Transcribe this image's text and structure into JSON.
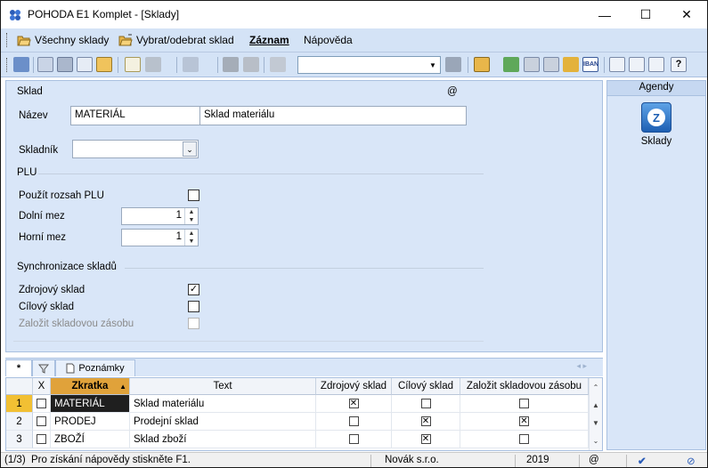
{
  "window": {
    "title": "POHODA E1 Komplet - [Sklady]",
    "minimize": "—",
    "maximize": "☐",
    "close": "✕"
  },
  "menubar": {
    "items": [
      {
        "label": "Všechny sklady",
        "icon": "folder-open-icon"
      },
      {
        "label": "Vybrat/odebrat sklad",
        "icon": "folder-select-icon"
      },
      {
        "label": "Záznam"
      },
      {
        "label": "Nápověda"
      }
    ]
  },
  "toolbar": {
    "filter_value": "",
    "icons": [
      "exit-icon",
      "copy-icon",
      "print-icon",
      "preview-icon",
      "export-icon",
      "new-record-icon",
      "check-icon",
      "back-arrow-icon",
      "save-icon",
      "save-disabled-icon",
      "duplicate-icon",
      "filter-icon",
      "folder-icon",
      "money-icon",
      "calculator-icon",
      "calc2-icon",
      "coins-icon",
      "iban-icon",
      "payments-icon",
      "list-icon",
      "report-icon",
      "help-icon"
    ]
  },
  "form": {
    "sklad_section": "Sklad",
    "at_label": "@",
    "nazev_label": "Název",
    "nazev_code": "MATERIÁL",
    "nazev_text": "Sklad materiálu",
    "skladnik_label": "Skladník",
    "skladnik_value": "",
    "plu_section": "PLU",
    "pouzit_rozsah_label": "Použít rozsah PLU",
    "pouzit_rozsah_checked": false,
    "dolni_mez_label": "Dolní mez",
    "dolni_mez_value": "1",
    "horni_mez_label": "Horní mez",
    "horni_mez_value": "1",
    "sync_section": "Synchronizace skladů",
    "zdrojovy_label": "Zdrojový sklad",
    "zdrojovy_checked": true,
    "cilovy_label": "Cílový sklad",
    "cilovy_checked": false,
    "zalozit_label": "Založit skladovou zásobu",
    "zalozit_checked": false
  },
  "agendy": {
    "header": "Agendy",
    "item_label": "Sklady",
    "item_icon_glyph": "Z"
  },
  "tabs": [
    {
      "label": "*",
      "icon": ""
    },
    {
      "label": "",
      "icon": "filter-icon"
    },
    {
      "label": "Poznámky",
      "icon": "note-icon"
    }
  ],
  "grid": {
    "columns": [
      "X",
      "Zkratka",
      "Text",
      "Zdrojový sklad",
      "Cílový sklad",
      "Založit skladovou zásobu"
    ],
    "sorted_indicator": "▲",
    "rows": [
      {
        "num": "1",
        "x": false,
        "zkratka": "MATERIÁL",
        "text": "Sklad materiálu",
        "zdrojovy": true,
        "cilovy": false,
        "zalozit": false
      },
      {
        "num": "2",
        "x": false,
        "zkratka": "PRODEJ",
        "text": "Prodejní sklad",
        "zdrojovy": false,
        "cilovy": true,
        "zalozit": true
      },
      {
        "num": "3",
        "x": false,
        "zkratka": "ZBOŽÍ",
        "text": "Sklad zboží",
        "zdrojovy": false,
        "cilovy": true,
        "zalozit": false
      }
    ]
  },
  "statusbar": {
    "record": "(1/3)",
    "help": "Pro získání nápovědy stiskněte F1.",
    "user": "Novák s.r.o.",
    "year": "2019",
    "at": "@"
  }
}
